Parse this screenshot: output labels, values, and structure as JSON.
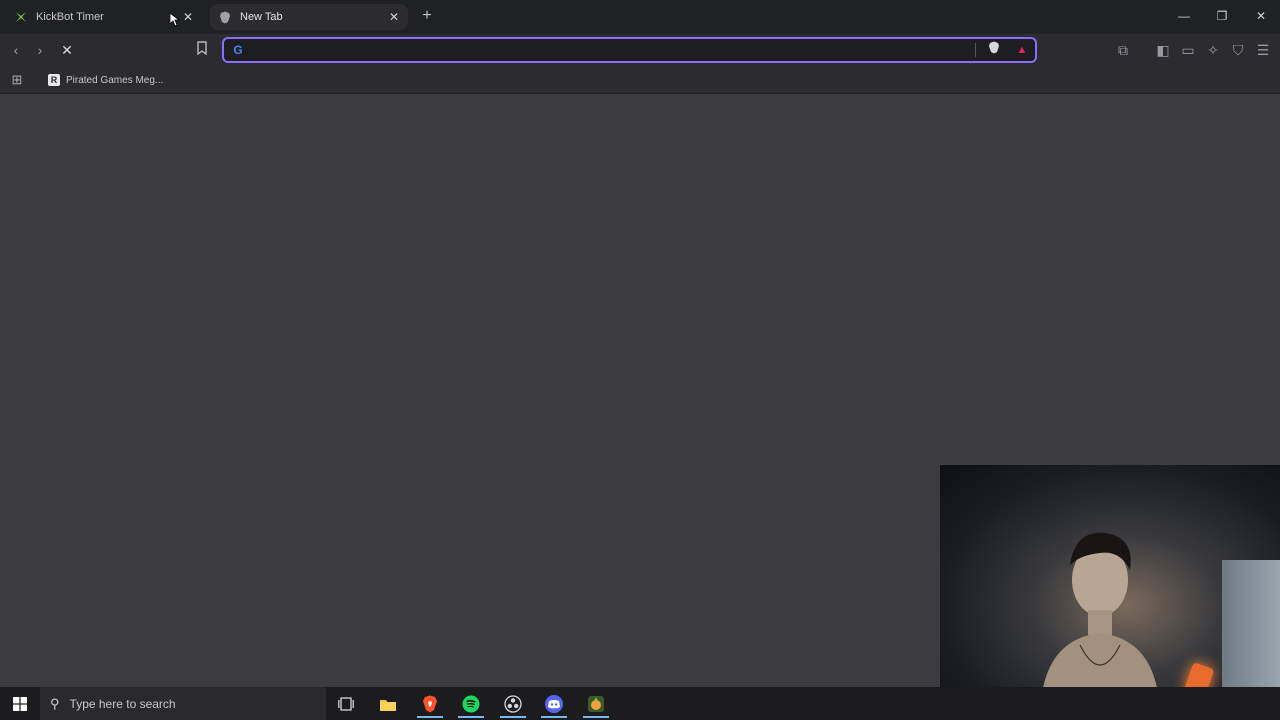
{
  "browser": {
    "tabs": [
      {
        "title": "KickBot Timer",
        "favicon": "kickbot-icon",
        "active": false
      },
      {
        "title": "New Tab",
        "favicon": "brave-icon",
        "active": true
      }
    ],
    "window_controls": [
      "minimize-icon",
      "restore-icon",
      "close-icon"
    ]
  },
  "toolbar": {
    "address_value": "",
    "search_engine_icon": "google-icon",
    "accent": "#8a6cff"
  },
  "bookmarks": [
    {
      "label": "Pirated Games Meg..."
    }
  ],
  "taskbar": {
    "search_placeholder": "Type here to search",
    "apps": [
      "task-view-icon",
      "file-explorer-icon",
      "brave-browser-icon",
      "spotify-icon",
      "obs-icon",
      "discord-icon",
      "app-icon"
    ]
  }
}
